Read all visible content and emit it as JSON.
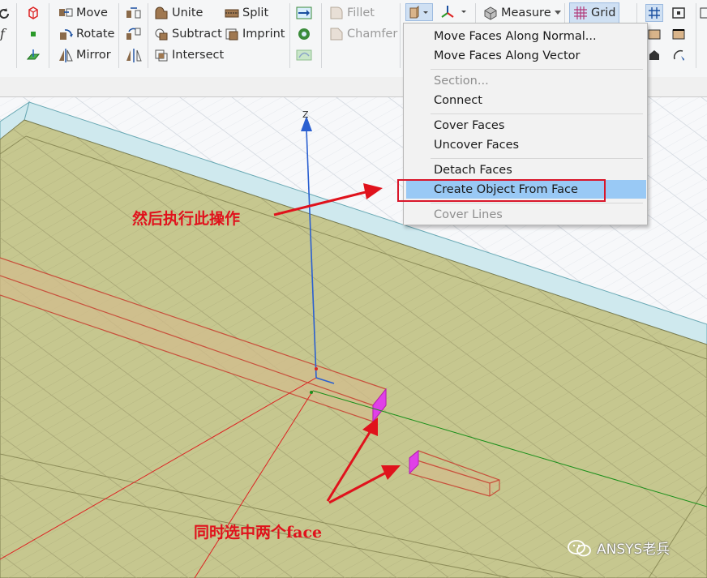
{
  "toolbar": {
    "ops": {
      "move": "Move",
      "rotate": "Rotate",
      "mirror": "Mirror"
    },
    "boolean": {
      "unite": "Unite",
      "subtract": "Subtract",
      "intersect": "Intersect",
      "split": "Split",
      "imprint": "Imprint"
    },
    "edge": {
      "fillet": "Fillet",
      "chamfer": "Chamfer"
    },
    "measure": "Measure",
    "grid": "Grid"
  },
  "menu": {
    "items": [
      {
        "label": "Move Faces Along Normal...",
        "enabled": true
      },
      {
        "label": "Move Faces Along Vector",
        "enabled": true
      },
      {
        "label": "Section...",
        "enabled": false
      },
      {
        "label": "Connect",
        "enabled": true
      },
      {
        "label": "Cover Faces",
        "enabled": true
      },
      {
        "label": "Uncover Faces",
        "enabled": true
      },
      {
        "label": "Detach Faces",
        "enabled": true
      },
      {
        "label": "Create Object From Face",
        "enabled": true,
        "highlighted": true
      },
      {
        "label": "Cover Lines",
        "enabled": false
      }
    ]
  },
  "viewport": {
    "axis_z": "Z"
  },
  "annotations": {
    "step2": "然后执行此操作",
    "step1": "同时选中两个face"
  },
  "watermark": "ANSYS老兵",
  "colors": {
    "highlight": "#99c9f5",
    "annotation_red": "#e0121c",
    "substrate": "#c8c890",
    "selected_face": "#e040e8"
  }
}
